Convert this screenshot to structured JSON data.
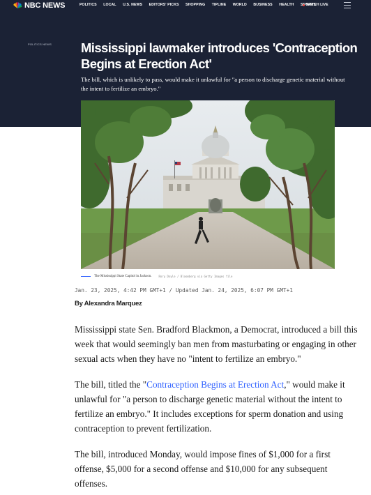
{
  "navbar": {
    "logo_text": "NBC NEWS",
    "links": [
      "POLITICS",
      "LOCAL",
      "U.S. NEWS",
      "EDITORS' PICKS",
      "SHOPPING",
      "TIPLINE",
      "WORLD",
      "BUSINESS",
      "HEALTH",
      "SPORTS"
    ],
    "watch_live": "WATCH LIVE",
    "menu_icon": "hamburger-menu-icon",
    "colors": {
      "background": "#1b2235",
      "live_dot": "#e8473f"
    }
  },
  "article": {
    "eyebrow": "POLITICS NEWS",
    "headline": "Mississippi lawmaker introduces 'Contraception Begins at Erection Act'",
    "dek": "The bill, which is unlikely to pass, would make it unlawful for \"a person to discharge genetic material without the intent to fertilize an embryo.\"",
    "photo": {
      "caption": "The Mississippi State Capitol in Jackson.",
      "credit": "Rory Doyle / Bloomberg via Getty Images file"
    },
    "dateline": "Jan. 23, 2025, 4:42 PM GMT+1 / Updated Jan. 24, 2025, 6:07 PM GMT+1",
    "byline": "By Alexandra Marquez",
    "paragraphs": [
      {
        "text": "Mississippi state Sen. Bradford Blackmon, a Democrat, introduced a bill this week that would seemingly ban men from masturbating or engaging in other sexual acts when they have no \"intent to fertilize an embryo.\""
      },
      {
        "before": "The bill, titled the \"",
        "link": "Contraception Begins at Erection Act",
        "after": ",\" would make it unlawful for \"a person to discharge genetic material without the intent to fertilize an embryo.\" It includes exceptions for sperm donation and using contraception to prevent fertilization."
      },
      {
        "text": "The bill, introduced Monday, would impose fines of $1,000 for a first offense, $5,000 for a second offense and $10,000 for any subsequent offenses."
      }
    ],
    "link_color": "#3061ff"
  }
}
